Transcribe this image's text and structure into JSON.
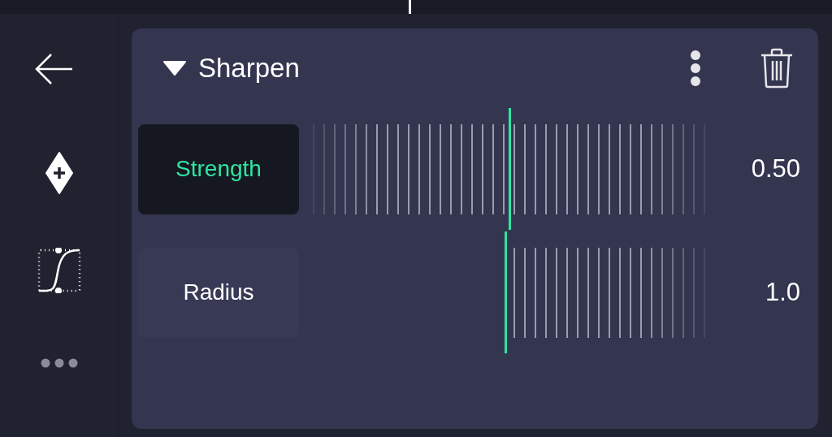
{
  "effect": {
    "title": "Sharpen",
    "expanded": true
  },
  "parameters": [
    {
      "label": "Strength",
      "kind": "bipolar",
      "selected": true,
      "level": 0.5,
      "value": "0.50"
    },
    {
      "label": "Radius",
      "kind": "unipolar",
      "selected": false,
      "level": 0.49,
      "value": "1.0"
    }
  ]
}
